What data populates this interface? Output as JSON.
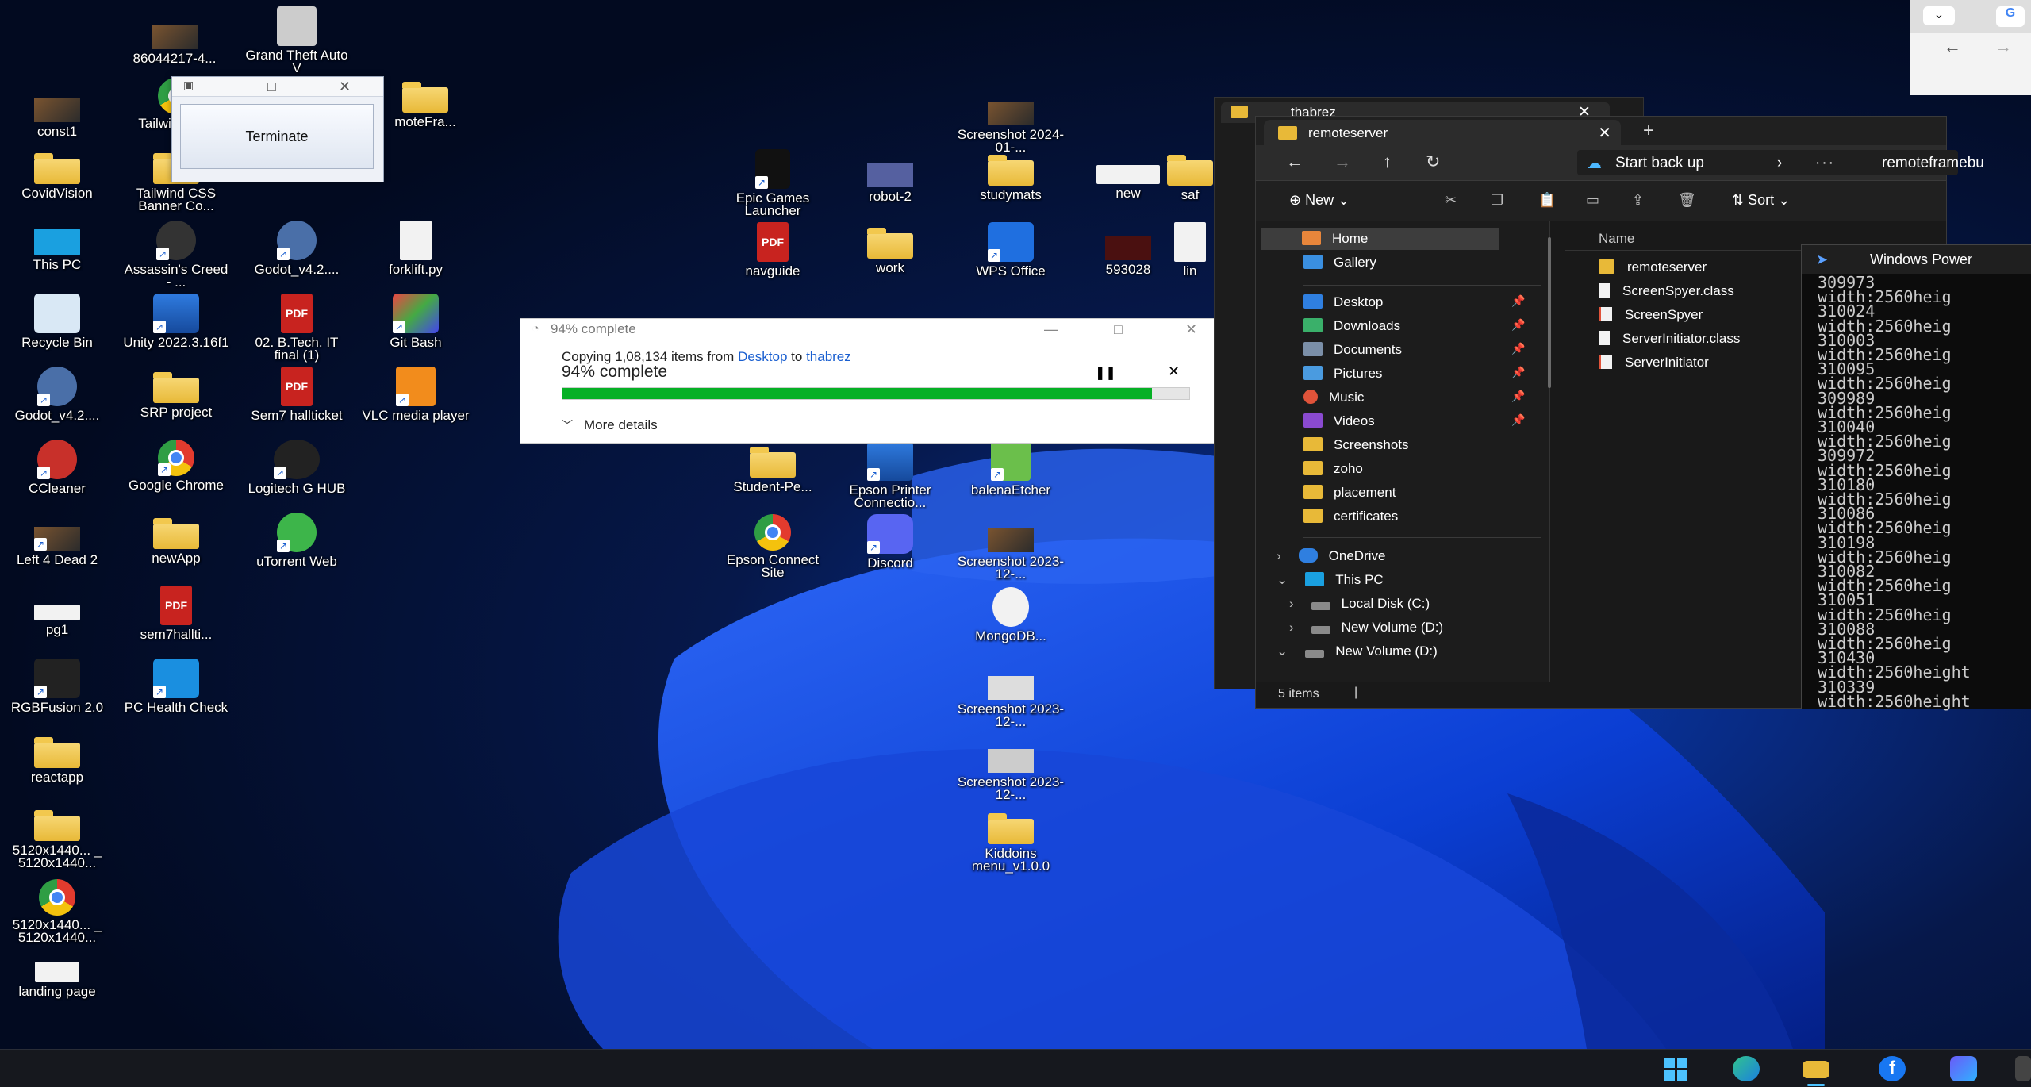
{
  "desktop": {
    "icons": [
      {
        "label": "86044217-4...",
        "kind": "thumb"
      },
      {
        "label": "Grand Theft Auto V",
        "kind": "game"
      },
      {
        "label": "const1",
        "kind": "thumb"
      },
      {
        "label": "Tailwi Banne",
        "kind": "chrome"
      },
      {
        "label": "moteFra...",
        "kind": "folder"
      },
      {
        "label": "CovidVision",
        "kind": "folder"
      },
      {
        "label": "Tailwind CSS Banner Co...",
        "kind": "folder"
      },
      {
        "label": "This PC",
        "kind": "pc"
      },
      {
        "label": "Assassin's Creed - ...",
        "kind": "game"
      },
      {
        "label": "Godot_v4.2....",
        "kind": "game"
      },
      {
        "label": "forklift.py",
        "kind": "doc"
      },
      {
        "label": "Recycle Bin",
        "kind": "blue"
      },
      {
        "label": "Unity 2022.3.16f1",
        "kind": "blue"
      },
      {
        "label": "02. B.Tech. IT final (1)",
        "kind": "pdf"
      },
      {
        "label": "Git Bash",
        "kind": "dark"
      },
      {
        "label": "Godot_v4.2....",
        "kind": "game"
      },
      {
        "label": "SRP project",
        "kind": "folder"
      },
      {
        "label": "Sem7 hallticket",
        "kind": "pdf"
      },
      {
        "label": "VLC media player",
        "kind": "game"
      },
      {
        "label": "CCleaner",
        "kind": "game"
      },
      {
        "label": "Google Chrome",
        "kind": "chrome"
      },
      {
        "label": "Logitech G HUB",
        "kind": "dark"
      },
      {
        "label": "Left 4 Dead 2",
        "kind": "thumb"
      },
      {
        "label": "newApp",
        "kind": "folder"
      },
      {
        "label": "uTorrent Web",
        "kind": "game"
      },
      {
        "label": "pg1",
        "kind": "doc"
      },
      {
        "label": "sem7hallti...",
        "kind": "pdf"
      },
      {
        "label": "RGBFusion 2.0",
        "kind": "dark"
      },
      {
        "label": "PC Health Check",
        "kind": "blue"
      },
      {
        "label": "reactapp",
        "kind": "folder"
      },
      {
        "label": "5120x1440... _ 5120x1440...",
        "kind": "folder"
      },
      {
        "label": "5120x1440... _ 5120x1440...",
        "kind": "chrome"
      },
      {
        "label": "landing page",
        "kind": "doc"
      },
      {
        "label": "Screenshot 2024-01-...",
        "kind": "thumb"
      },
      {
        "label": "Epic Games Launcher",
        "kind": "dark"
      },
      {
        "label": "robot-2",
        "kind": "thumb"
      },
      {
        "label": "studymats",
        "kind": "folder"
      },
      {
        "label": "new",
        "kind": "thumb"
      },
      {
        "label": "saf",
        "kind": "folder"
      },
      {
        "label": "navguide",
        "kind": "pdf"
      },
      {
        "label": "work",
        "kind": "folder"
      },
      {
        "label": "WPS Office",
        "kind": "blue"
      },
      {
        "label": "593028",
        "kind": "thumb"
      },
      {
        "label": "lin",
        "kind": "doc"
      },
      {
        "label": "Student-Pe...",
        "kind": "folder"
      },
      {
        "label": "Epson Printer Connectio...",
        "kind": "blue"
      },
      {
        "label": "balenaEtcher",
        "kind": "game"
      },
      {
        "label": "Epson Connect Site",
        "kind": "chrome"
      },
      {
        "label": "Discord",
        "kind": "blue"
      },
      {
        "label": "Screenshot 2023-12-...",
        "kind": "thumb"
      },
      {
        "label": "MongoDB...",
        "kind": "doc"
      },
      {
        "label": "Screenshot 2023-12-...",
        "kind": "thumb"
      },
      {
        "label": "Screenshot 2023-12-...",
        "kind": "thumb"
      },
      {
        "label": "Kiddoins menu_v1.0.0",
        "kind": "folder"
      }
    ]
  },
  "terminate_window": {
    "button_label": "Terminate"
  },
  "copy_dialog": {
    "title": "94% complete",
    "line_prefix": "Copying 1,08,134 items from ",
    "from": "Desktop",
    "to_word": " to ",
    "to": "thabrez",
    "status": "94% complete",
    "progress": 0.94,
    "more_details": "More details",
    "accent": "#06b025"
  },
  "explorer_back": {
    "tab_title": "thabrez"
  },
  "explorer": {
    "tab_title": "remoteserver",
    "backup_label": "Start back up",
    "address_path": "remoteframebu",
    "new_label": "New",
    "sort_label": "Sort",
    "column_name": "Name",
    "nav_items": [
      {
        "label": "Home"
      },
      {
        "label": "Gallery"
      },
      {
        "label": "Desktop"
      },
      {
        "label": "Downloads"
      },
      {
        "label": "Documents"
      },
      {
        "label": "Pictures"
      },
      {
        "label": "Music"
      },
      {
        "label": "Videos"
      },
      {
        "label": "Screenshots"
      },
      {
        "label": "zoho"
      },
      {
        "label": "placement"
      },
      {
        "label": "certificates"
      },
      {
        "label": "OneDrive"
      },
      {
        "label": "This PC"
      },
      {
        "label": "Local Disk (C:)"
      },
      {
        "label": "New Volume (D:)"
      },
      {
        "label": "New Volume (D:)"
      }
    ],
    "files": [
      {
        "name": "remoteserver",
        "type": "folder"
      },
      {
        "name": "ScreenSpyer.class",
        "type": "file"
      },
      {
        "name": "ScreenSpyer",
        "type": "java"
      },
      {
        "name": "ServerInitiator.class",
        "type": "file"
      },
      {
        "name": "ServerInitiator",
        "type": "java"
      }
    ],
    "status": "5 items"
  },
  "powershell": {
    "title": "Windows Power",
    "lines": [
      "309973",
      "width:2560heig",
      "310024",
      "width:2560heig",
      "310003",
      "width:2560heig",
      "310095",
      "width:2560heig",
      "309989",
      "width:2560heig",
      "310040",
      "width:2560heig",
      "309972",
      "width:2560heig",
      "310180",
      "width:2560heig",
      "310086",
      "width:2560heig",
      "310198",
      "width:2560heig",
      "310082",
      "width:2560heig",
      "310051",
      "width:2560heig",
      "310088",
      "width:2560heig",
      "310430",
      "width:2560height",
      "310339",
      "width:2560height"
    ]
  }
}
